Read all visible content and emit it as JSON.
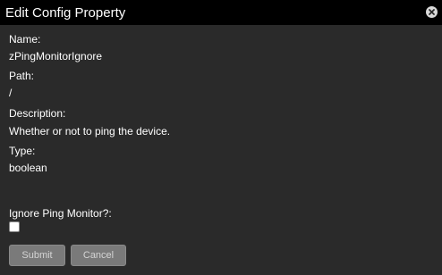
{
  "dialog": {
    "title": "Edit Config Property",
    "close_icon": "close-circle-icon"
  },
  "fields": {
    "name_label": "Name:",
    "name_value": "zPingMonitorIgnore",
    "path_label": "Path:",
    "path_value": "/",
    "description_label": "Description:",
    "description_value": "Whether or not to ping the device.",
    "type_label": "Type:",
    "type_value": "boolean"
  },
  "input": {
    "checkbox_label": "Ignore Ping Monitor?:",
    "checked": false
  },
  "buttons": {
    "submit_label": "Submit",
    "cancel_label": "Cancel"
  },
  "colors": {
    "titlebar_bg": "#000000",
    "dialog_bg": "#2a2a2a",
    "button_bg": "#7a7a7a",
    "button_text": "#d4d4d4"
  }
}
